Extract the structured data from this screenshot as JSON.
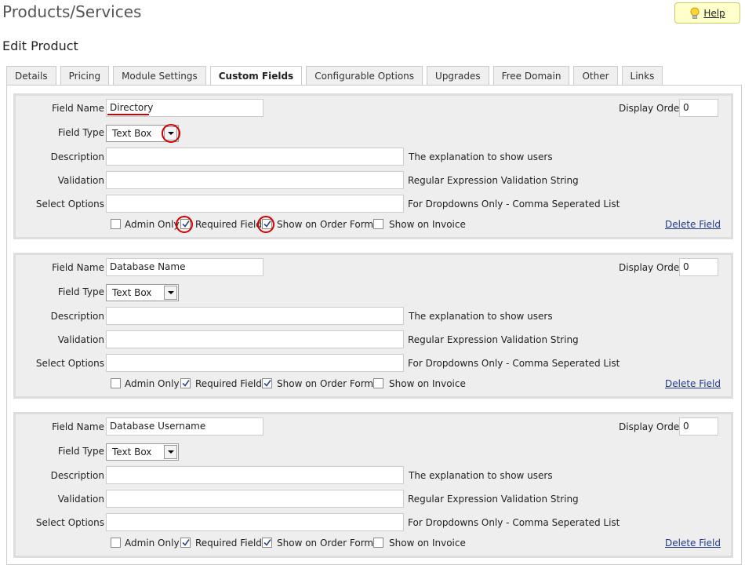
{
  "page": {
    "title": "Products/Services",
    "subtitle": "Edit Product",
    "help_label": "Help"
  },
  "tabs": [
    {
      "label": "Details"
    },
    {
      "label": "Pricing"
    },
    {
      "label": "Module Settings"
    },
    {
      "label": "Custom Fields",
      "active": true
    },
    {
      "label": "Configurable Options"
    },
    {
      "label": "Upgrades"
    },
    {
      "label": "Free Domain"
    },
    {
      "label": "Other"
    },
    {
      "label": "Links"
    }
  ],
  "labels": {
    "field_name": "Field Name",
    "field_type": "Field Type",
    "description": "Description",
    "validation": "Validation",
    "select_options": "Select Options",
    "display_order": "Display Order",
    "description_hint": "The explanation to show users",
    "validation_hint": "Regular Expression Validation String",
    "select_options_hint": "For Dropdowns Only - Comma Seperated List",
    "admin_only": "Admin Only",
    "required_field": "Required Field",
    "show_on_order_form": "Show on Order Form",
    "show_on_invoice": "Show on Invoice",
    "delete_field": "Delete Field"
  },
  "fields": [
    {
      "field_name": "Directory",
      "field_type": "Text Box",
      "display_order": "0",
      "description": "",
      "validation": "",
      "select_options": "",
      "admin_only": false,
      "required_field": true,
      "show_on_order_form": true,
      "show_on_invoice": false
    },
    {
      "field_name": "Database Name",
      "field_type": "Text Box",
      "display_order": "0",
      "description": "",
      "validation": "",
      "select_options": "",
      "admin_only": false,
      "required_field": true,
      "show_on_order_form": true,
      "show_on_invoice": false
    },
    {
      "field_name": "Database Username",
      "field_type": "Text Box",
      "display_order": "0",
      "description": "",
      "validation": "",
      "select_options": "",
      "admin_only": false,
      "required_field": true,
      "show_on_order_form": true,
      "show_on_invoice": false
    }
  ],
  "colors": {
    "annotation": "#d40000",
    "help_bg": "#ffffcc",
    "link": "#1f3a8c"
  }
}
